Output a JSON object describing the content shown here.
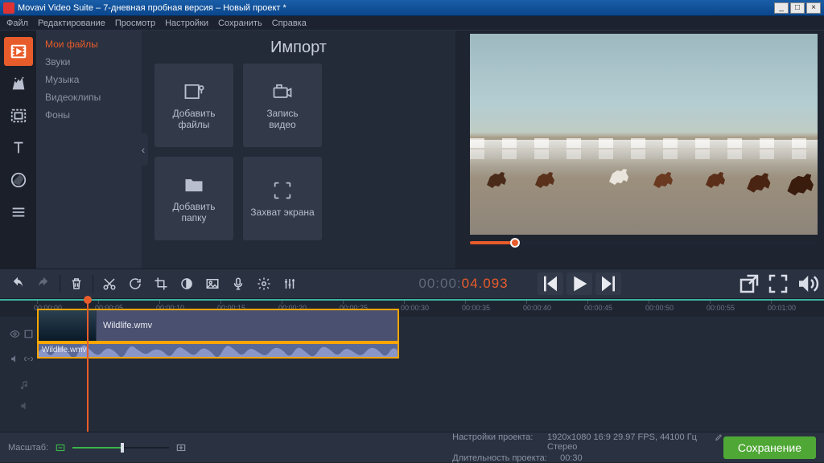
{
  "window": {
    "title": "Movavi Video Suite – 7-дневная пробная версия – Новый проект *"
  },
  "menu": {
    "items": [
      "Файл",
      "Редактирование",
      "Просмотр",
      "Настройки",
      "Сохранить",
      "Справка"
    ]
  },
  "import_panel": {
    "title": "Импорт",
    "side": {
      "items": [
        "Мои файлы",
        "Звуки",
        "Музыка",
        "Видеоклипы",
        "Фоны"
      ],
      "active": 0
    },
    "tiles": {
      "add_files": "Добавить\nфайлы",
      "record_video": "Запись\nвидео",
      "add_folder": "Добавить\nпапку",
      "capture_screen": "Захват экрана"
    }
  },
  "preview": {
    "timecode_gray": "00:00:",
    "timecode_red": "04.093"
  },
  "timeline": {
    "ticks": [
      "00:00:00",
      "00:00:05",
      "00:00:10",
      "00:00:15",
      "00:00:20",
      "00:00:25",
      "00:00:30",
      "00:00:35",
      "00:00:40",
      "00:00:45",
      "00:00:50",
      "00:00:55",
      "00:01:00"
    ],
    "clip_video": "Wildlife.wmv",
    "clip_audio": "Wildlife.wmv"
  },
  "footer": {
    "zoom_label": "Масштаб:",
    "proj_settings_label": "Настройки проекта:",
    "proj_settings_value": "1920x1080 16:9 29.97 FPS, 44100 Гц Стерео",
    "proj_duration_label": "Длительность проекта:",
    "proj_duration_value": "00:30",
    "save_btn": "Сохранение"
  }
}
